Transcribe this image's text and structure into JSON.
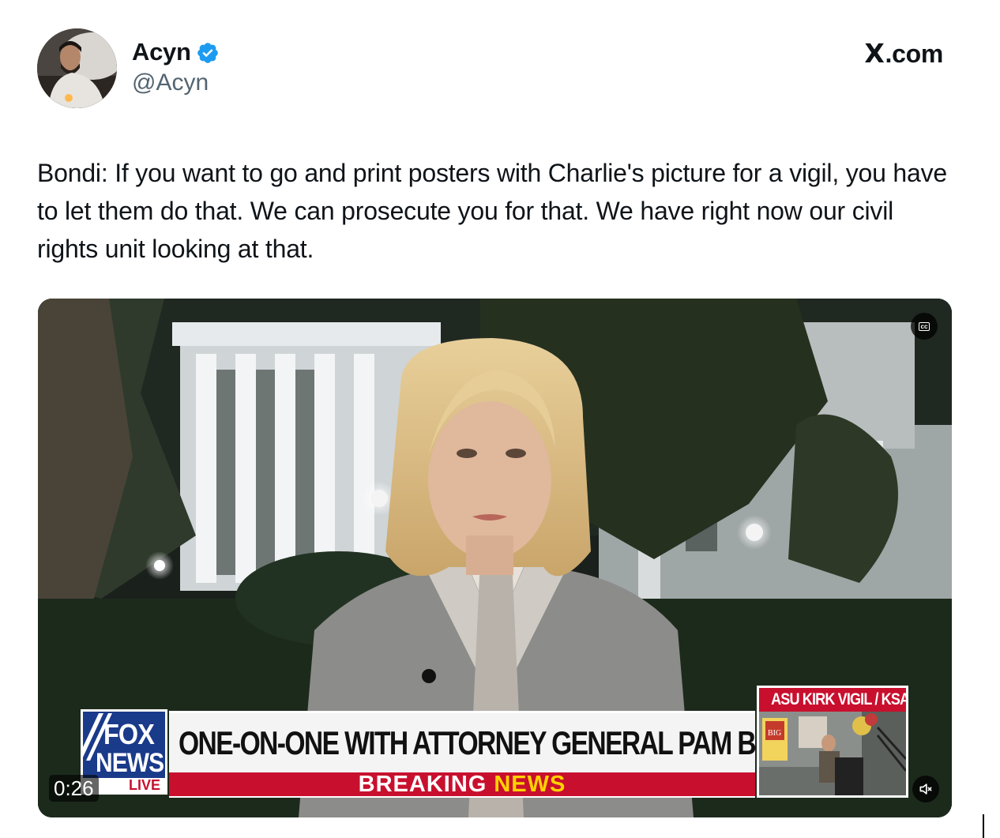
{
  "author": {
    "display_name": "Acyn",
    "handle": "@Acyn",
    "verified": true,
    "verified_color": "#1d9bf0"
  },
  "site_label": "X.com",
  "tweet": {
    "text": "Bondi: If you want to go and print posters with Charlie's picture for a vigil, you have to let them do that. We can prosecute you for that. We have right now our civil rights unit looking at that."
  },
  "video": {
    "timestamp": "0:26",
    "cc_label": "cc",
    "broadcast": {
      "logo_top": "FOX",
      "logo_bottom": "NEWS",
      "logo_live": "LIVE",
      "headline": "ONE-ON-ONE WITH ATTORNEY GENERAL PAM BONDI",
      "breaking_part1": "BREAKING",
      "breaking_part2": "NEWS",
      "pip_title": "ASU KIRK VIGIL / KSAZ",
      "pip_poster_text": "BIG"
    },
    "icons": {
      "cc": "closed-captions-icon",
      "mute": "speaker-muted-icon"
    }
  }
}
